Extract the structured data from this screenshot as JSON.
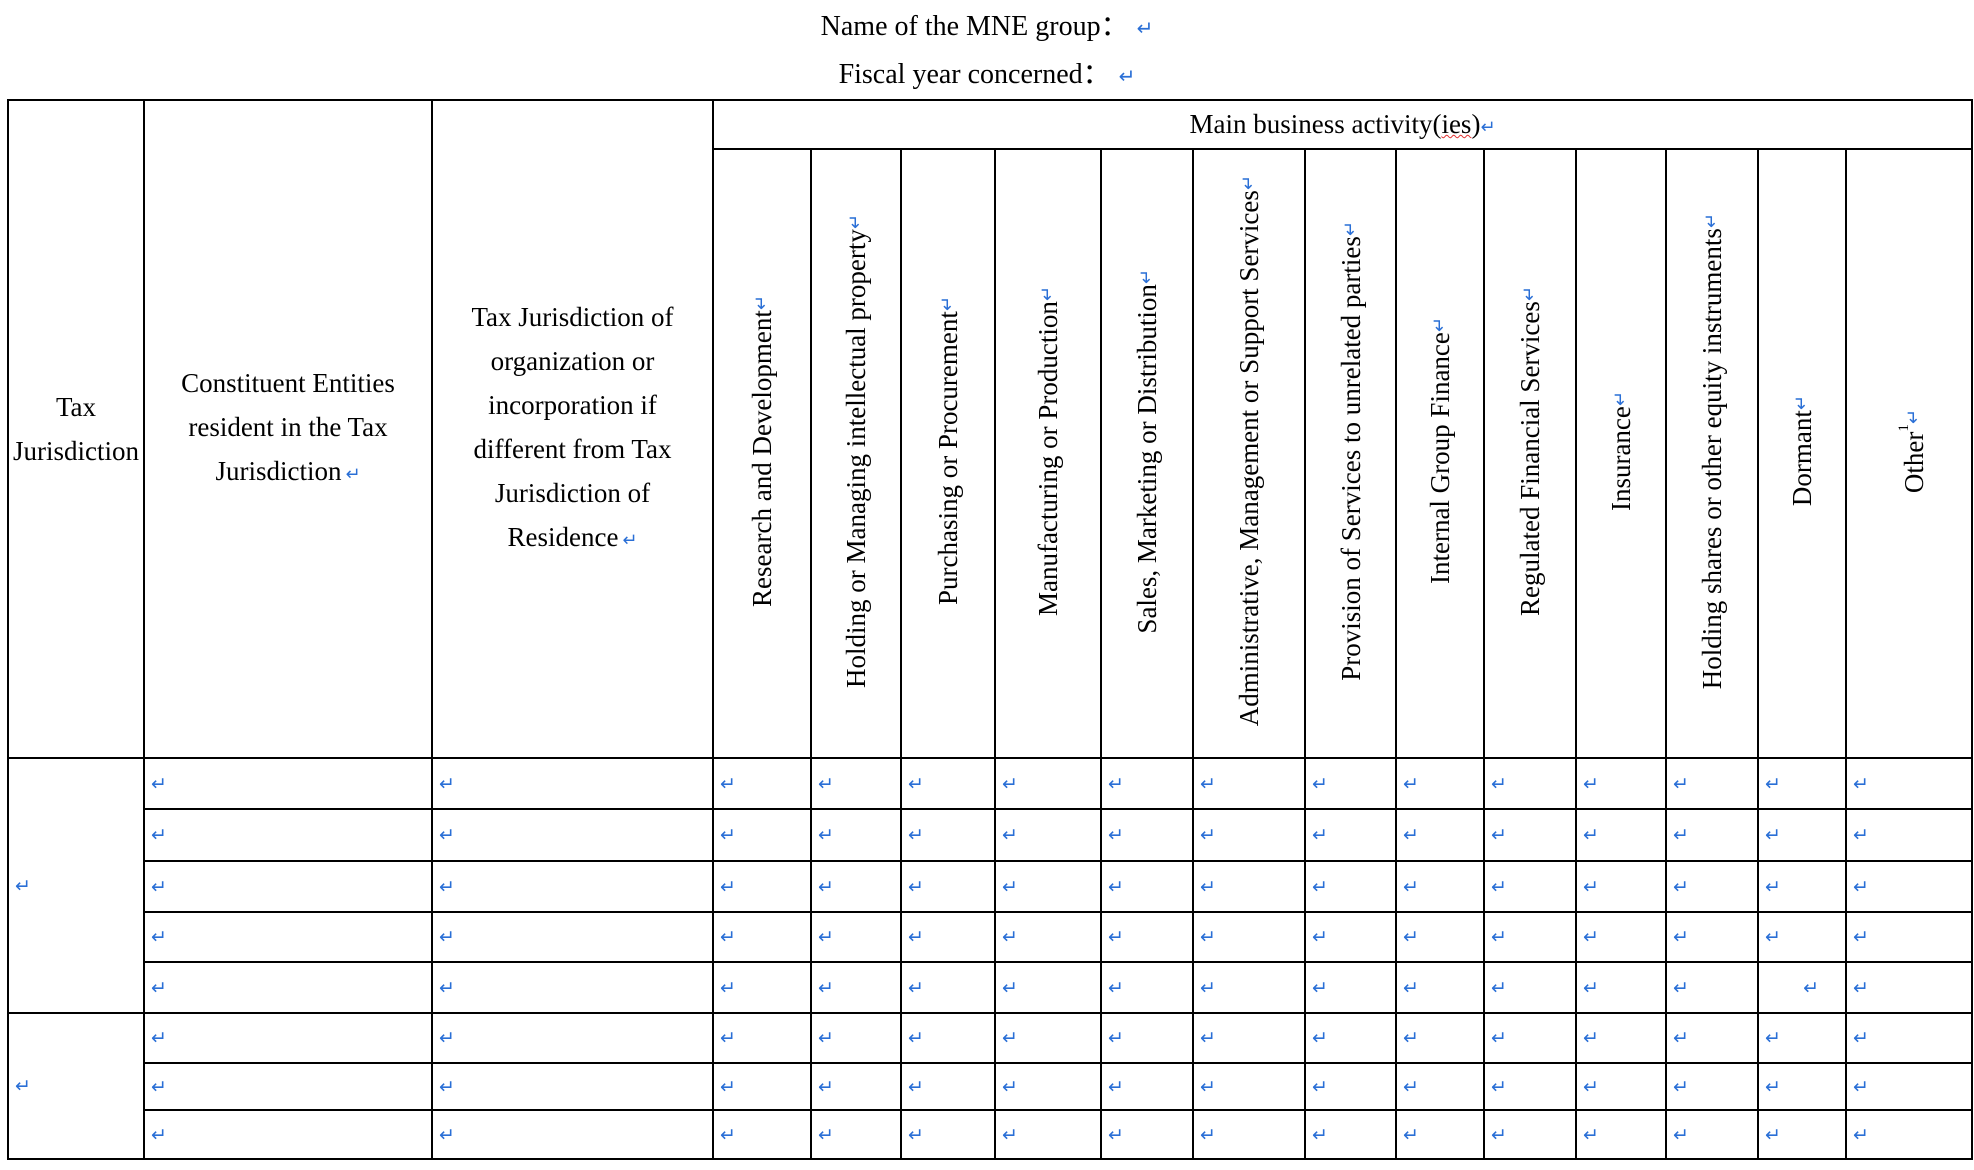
{
  "header": {
    "name_label": "Name of the MNE group：",
    "fiscal_label": "Fiscal year concerned：",
    "para_mark": "↵"
  },
  "columns": {
    "tax_jurisdiction": "Tax Jurisdiction",
    "constituent_entities": "Constituent Entities resident in the Tax Jurisdiction",
    "org_jurisdiction": "Tax Jurisdiction of organization or incorporation if different from Tax Jurisdiction of Residence",
    "main_activity_prefix": "Main business activity(",
    "main_activity_mid": "ies",
    "main_activity_suffix": ")"
  },
  "activities": [
    "Research and Development",
    "Holding or Managing intellectual property",
    "Purchasing or Procurement",
    "Manufacturing or Production",
    "Sales, Marketing or Distribution",
    "Administrative, Management or Support Services",
    "Provision of Services to unrelated parties",
    "Internal Group Finance",
    "Regulated Financial Services",
    "Insurance",
    "Holding shares or other equity instruments",
    "Dormant",
    "Other"
  ],
  "other_footnote": "1",
  "groups": [
    {
      "jurisdiction": "",
      "rows": 5
    },
    {
      "jurisdiction": "",
      "rows": 3
    }
  ]
}
